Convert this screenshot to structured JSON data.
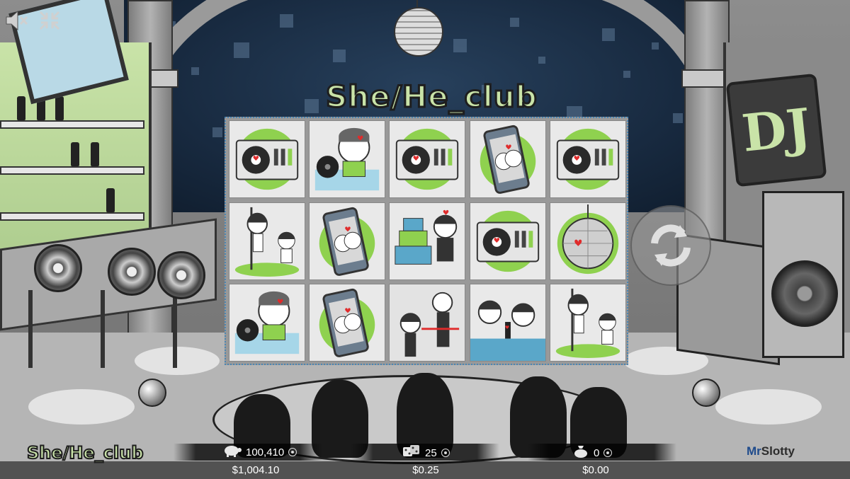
{
  "game": {
    "title_logo": "She/He_club",
    "provider": {
      "part1": "Mr",
      "part2": "Slotty"
    }
  },
  "controls": {
    "sound_icon": "speaker-muted-icon",
    "fullscreen_icon": "fullscreen-icon",
    "spin_icon": "spin-arrows-icon"
  },
  "reels": {
    "columns": 5,
    "rows": 3,
    "grid": [
      [
        "turntable",
        "dj-boy",
        "turntable",
        "phone-couple",
        "turntable"
      ],
      [
        "pole-dancer",
        "phone-couple",
        "cake-boy",
        "turntable",
        "disco-ball"
      ],
      [
        "dj-boy",
        "phone-couple",
        "bouncer",
        "bartender",
        "pole-dancer"
      ]
    ]
  },
  "stats": {
    "credits": {
      "icon": "piggy-bank-icon",
      "value": "100,410",
      "money": "$1,004.10"
    },
    "bet": {
      "icon": "dice-icon",
      "value": "25",
      "money": "$0.25"
    },
    "win": {
      "icon": "coin-bag-icon",
      "value": "0",
      "money": "$0.00"
    }
  },
  "colors": {
    "logo_green": "#c9e3a8",
    "reel_accent": "#8fd14f",
    "heart": "#e02b2b",
    "brand_blue": "#1f4b8c"
  }
}
